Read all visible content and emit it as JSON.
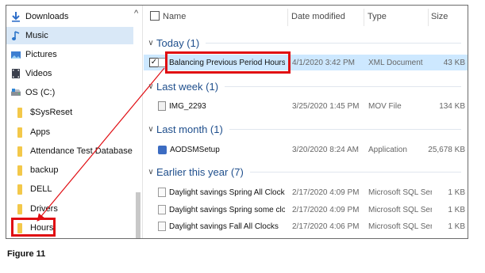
{
  "nav": {
    "items": [
      {
        "label": "Downloads",
        "icon": "download-arrow-icon",
        "level": 1
      },
      {
        "label": "Music",
        "icon": "music-note-icon",
        "level": 1,
        "selected": true
      },
      {
        "label": "Pictures",
        "icon": "pictures-icon",
        "level": 1
      },
      {
        "label": "Videos",
        "icon": "videos-icon",
        "level": 1
      },
      {
        "label": "OS (C:)",
        "icon": "drive-icon",
        "level": 1
      },
      {
        "label": "$SysReset",
        "icon": "folder-icon",
        "level": 2
      },
      {
        "label": "Apps",
        "icon": "folder-icon",
        "level": 2
      },
      {
        "label": "Attendance Test Database",
        "icon": "folder-icon",
        "level": 2
      },
      {
        "label": "backup",
        "icon": "folder-icon",
        "level": 2
      },
      {
        "label": "DELL",
        "icon": "folder-icon",
        "level": 2
      },
      {
        "label": "Drivers",
        "icon": "folder-icon",
        "level": 2
      },
      {
        "label": "Hours",
        "icon": "folder-icon",
        "level": 2,
        "boxed": true
      }
    ]
  },
  "columns": {
    "name": "Name",
    "date": "Date modified",
    "type": "Type",
    "size": "Size"
  },
  "groups": [
    {
      "label": "Today (1)",
      "rows": [
        {
          "name": "Balancing Previous Period Hours to Pa...",
          "date": "4/1/2020 3:42 PM",
          "type": "XML Document",
          "size": "43 KB",
          "icon": "xml-file-icon",
          "checked": true,
          "highlight": true,
          "boxed": true
        }
      ]
    },
    {
      "label": "Last week (1)",
      "rows": [
        {
          "name": "IMG_2293",
          "date": "3/25/2020 1:45 PM",
          "type": "MOV File",
          "size": "134 KB",
          "icon": "mov-file-icon"
        }
      ]
    },
    {
      "label": "Last month (1)",
      "rows": [
        {
          "name": "AODSMSetup",
          "date": "3/20/2020 8:24 AM",
          "type": "Application",
          "size": "25,678 KB",
          "icon": "application-icon"
        }
      ]
    },
    {
      "label": "Earlier this year (7)",
      "rows": [
        {
          "name": "Daylight savings Spring All Clocks",
          "date": "2/17/2020 4:09 PM",
          "type": "Microsoft SQL Ser...",
          "size": "1 KB",
          "icon": "sql-file-icon"
        },
        {
          "name": "Daylight savings Spring some clocks",
          "date": "2/17/2020 4:09 PM",
          "type": "Microsoft SQL Ser...",
          "size": "1 KB",
          "icon": "sql-file-icon"
        },
        {
          "name": "Daylight savings Fall All Clocks",
          "date": "2/17/2020 4:06 PM",
          "type": "Microsoft SQL Ser...",
          "size": "1 KB",
          "icon": "sql-file-icon"
        }
      ]
    }
  ],
  "checkmark": "✓",
  "caption": "Figure 11",
  "colors": {
    "annotation_red": "#e00d12",
    "group_blue": "#1e4e8c",
    "highlight": "#cde8ff"
  }
}
